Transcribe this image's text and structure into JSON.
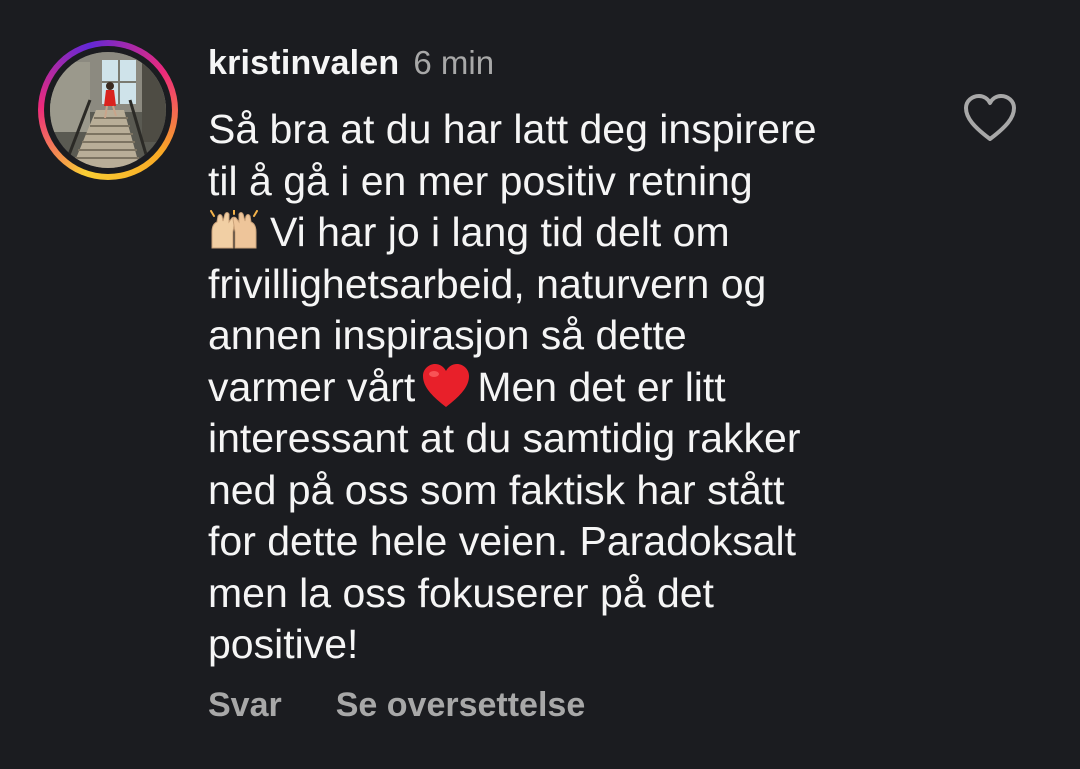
{
  "comment": {
    "username": "kristinvalen",
    "time": "6 min",
    "lines": [
      "Så bra at du har latt deg inspirere",
      "til å gå i en mer positiv retning",
      "Vi har jo i lang tid delt om",
      "frivillighetsarbeid, naturvern og",
      "annen inspirasjon så dette",
      "varmer vårt",
      "Men det er litt",
      "interessant at du samtidig rakker",
      "ned på oss som faktisk har stått",
      "for dette hele veien. Paradoksalt",
      "men la oss fokuserer på det",
      "positive!"
    ],
    "emoji": {
      "line3": "raising-hands-emoji",
      "line6": "red-heart-emoji"
    }
  },
  "actions": {
    "reply_label": "Svar",
    "translate_label": "Se oversettelse"
  },
  "icons": {
    "like": "heart-outline-icon"
  },
  "colors": {
    "background": "#1b1c20",
    "text": "#f5f5f5",
    "secondary_text": "#a8a8a8",
    "heart": "#e8202a"
  }
}
